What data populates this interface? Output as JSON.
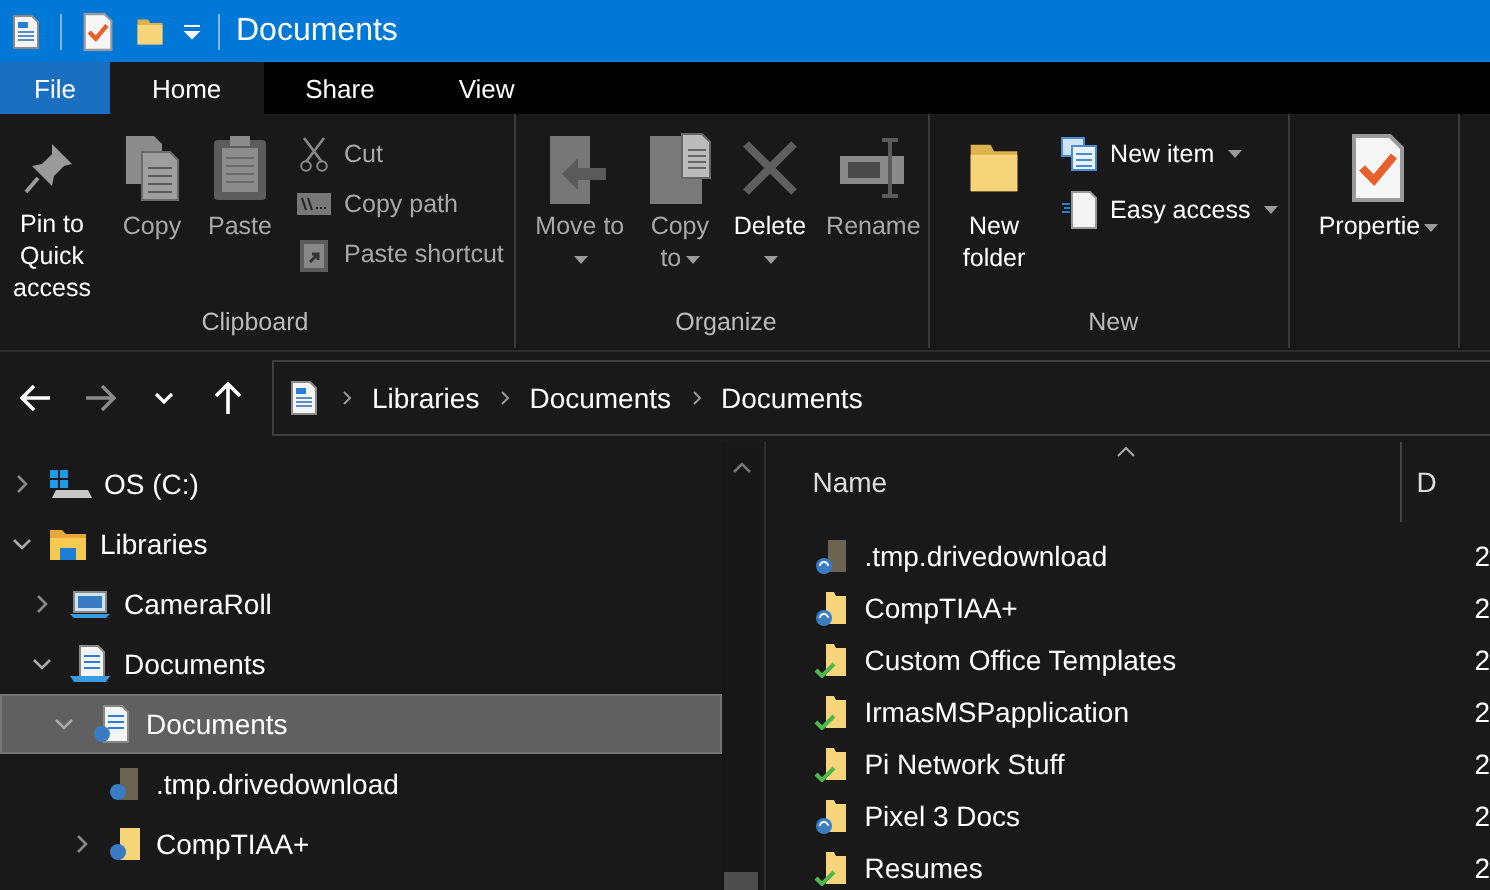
{
  "window": {
    "title": "Documents"
  },
  "tabs": [
    {
      "label": "File",
      "kind": "file",
      "selected": false
    },
    {
      "label": "Home",
      "kind": "tab",
      "selected": true
    },
    {
      "label": "Share",
      "kind": "tab",
      "selected": false
    },
    {
      "label": "View",
      "kind": "tab",
      "selected": false
    }
  ],
  "ribbon": {
    "groups": [
      {
        "label": "Clipboard",
        "items": [
          {
            "kind": "large",
            "label": "Pin to Quick access",
            "disabled": false,
            "dropdown": false
          },
          {
            "kind": "large",
            "label": "Copy",
            "disabled": true,
            "dropdown": false
          },
          {
            "kind": "large",
            "label": "Paste",
            "disabled": true,
            "dropdown": false
          },
          {
            "kind": "stack",
            "buttons": [
              {
                "label": "Cut",
                "disabled": true,
                "dropdown": false
              },
              {
                "label": "Copy path",
                "disabled": true,
                "dropdown": false
              },
              {
                "label": "Paste shortcut",
                "disabled": true,
                "dropdown": false
              }
            ]
          }
        ]
      },
      {
        "label": "Organize",
        "items": [
          {
            "kind": "large",
            "label": "Move to",
            "disabled": true,
            "dropdown": true
          },
          {
            "kind": "large",
            "label": "Copy to",
            "disabled": true,
            "dropdown": true
          },
          {
            "kind": "large",
            "label": "Delete",
            "disabled": false,
            "dropdown": true
          },
          {
            "kind": "large",
            "label": "Rename",
            "disabled": true,
            "dropdown": false
          }
        ]
      },
      {
        "label": "New",
        "items": [
          {
            "kind": "large",
            "label": "New folder",
            "disabled": false,
            "dropdown": false
          },
          {
            "kind": "stack",
            "buttons": [
              {
                "label": "New item",
                "disabled": false,
                "dropdown": true
              },
              {
                "label": "Easy access",
                "disabled": false,
                "dropdown": true
              }
            ]
          }
        ]
      },
      {
        "items": [
          {
            "kind": "large",
            "label": "Propertie",
            "disabled": false,
            "dropdown": true
          }
        ]
      }
    ]
  },
  "navigation": {
    "back_disabled": false,
    "forward_disabled": true
  },
  "address_bar": {
    "breadcrumbs": [
      "Libraries",
      "Documents",
      "Documents"
    ]
  },
  "tree": {
    "items": [
      {
        "label": "OS (C:)",
        "kind": "drive",
        "expanded": false,
        "selected": false
      },
      {
        "label": "Libraries",
        "kind": "libraries",
        "expanded": true,
        "selected": false,
        "children": [
          {
            "label": "CameraRoll",
            "kind": "library",
            "expanded": false,
            "selected": false
          },
          {
            "label": "Documents",
            "kind": "doclib",
            "expanded": true,
            "selected": false,
            "children": [
              {
                "label": "Documents",
                "kind": "docfolder",
                "expanded": true,
                "selected": true,
                "children": [
                  {
                    "label": ".tmp.drivedownload",
                    "kind": "syncfile",
                    "selected": false
                  },
                  {
                    "label": "CompTIAA+",
                    "kind": "syncfolder",
                    "expanded": false,
                    "selected": false
                  }
                ]
              }
            ]
          }
        ]
      }
    ]
  },
  "file_list": {
    "columns": [
      "Name",
      "D"
    ],
    "rows": [
      {
        "name": ".tmp.drivedownload",
        "kind": "file",
        "synced": false,
        "column_2": "2"
      },
      {
        "name": "CompTIAA+",
        "kind": "folder",
        "synced": false,
        "column_2": "2"
      },
      {
        "name": "Custom Office Templates",
        "kind": "folder",
        "synced": true,
        "column_2": "2"
      },
      {
        "name": "IrmasMSPapplication",
        "kind": "folder",
        "synced": true,
        "column_2": "2"
      },
      {
        "name": "Pi Network Stuff",
        "kind": "folder",
        "synced": true,
        "column_2": "2"
      },
      {
        "name": "Pixel 3 Docs",
        "kind": "folder",
        "synced": false,
        "column_2": "2"
      },
      {
        "name": "Resumes",
        "kind": "folder",
        "synced": true,
        "column_2": "2"
      }
    ]
  }
}
